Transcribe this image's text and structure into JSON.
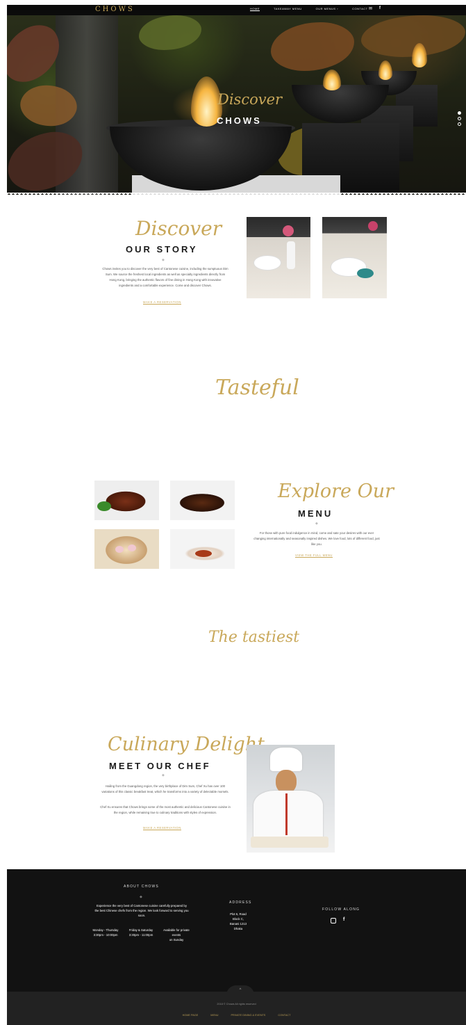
{
  "header": {
    "logo": "CHOWS",
    "nav": [
      "HOME",
      "TAKEAWAY MENU",
      "OUR MENUS",
      "CONTACT"
    ],
    "nav_dropdown_indicator": "›",
    "icons": [
      "envelope-icon",
      "facebook-icon"
    ]
  },
  "hero": {
    "script": "Discover",
    "title": "CHOWS"
  },
  "story": {
    "script": "Discover",
    "heading": "OUR STORY",
    "divider": "◆",
    "text": "Chows invites you to discover the very best of Cantonese cuisine, including the sumptuous Dim Sum. We source the freshest local ingredients as well as specialty ingredients directly from Hong Kong, bringing the authentic flavors of fine dining in Hong Kong with innovative ingredients and a comfortable experience. Come and discover Chows.",
    "link": "MAKE A RESERVATION"
  },
  "tasteful": {
    "script": "Tasteful"
  },
  "menu": {
    "script": "Explore Our",
    "heading": "MENU",
    "divider": "◆",
    "text": "For those with pure food indulgence in mind, come and sate your desires with our ever changing internationally and seasonally inspired dishes. We love food, lots of different food, just like you.",
    "link": "VIEW THE FULL MENU"
  },
  "the_best": {
    "script": "The tastiest"
  },
  "chef": {
    "script": "Culinary Delight",
    "heading": "MEET OUR CHEF",
    "divider": "◆",
    "text1": "Hailing from the Guangdong region, the very birthplace of Dim Sum, Chef Xu has over 100 variations of this classic breakfast treat, which he transforms into a variety of delectable morsels.",
    "text2": "Chef Xu ensures that Chows brings some of the most authentic and delicious Cantonese cuisine in the region, while remaining true to culinary traditions with styles of expression.",
    "link": "MAKE A RESERVATION"
  },
  "footer": {
    "about_heading": "ABOUT CHOWS",
    "about_divider": "◆",
    "about_text": "Experience the very best of Cantonese cuisine carefully prepared by the best Chinese chefs from the region. We look forward to serving you soon.",
    "hours": [
      {
        "days": "Monday - Thursday",
        "time": "3:30pm - 10:00pm"
      },
      {
        "days": "Friday & Saturday",
        "time": "3:30pm - 11:00pm"
      },
      {
        "days": "Available for private events",
        "time": "on Sunday"
      }
    ],
    "address_heading": "ADDRESS",
    "address_lines": [
      "Plot 6, Road",
      "Block C,",
      "Banani 1213",
      "Dhaka"
    ],
    "follow_heading": "FOLLOW ALONG",
    "social_icons": [
      "instagram-icon",
      "facebook-icon"
    ],
    "to_top": "^",
    "copyright": "2018 © Chows All rights reserved",
    "links": [
      "HOME PAGE",
      "MENU",
      "PRIVATE DINING & EVENTS",
      "CONTACT"
    ]
  },
  "colors": {
    "gold": "#c9a85a",
    "dark": "#121212",
    "topbar": "#0b0b0b"
  }
}
